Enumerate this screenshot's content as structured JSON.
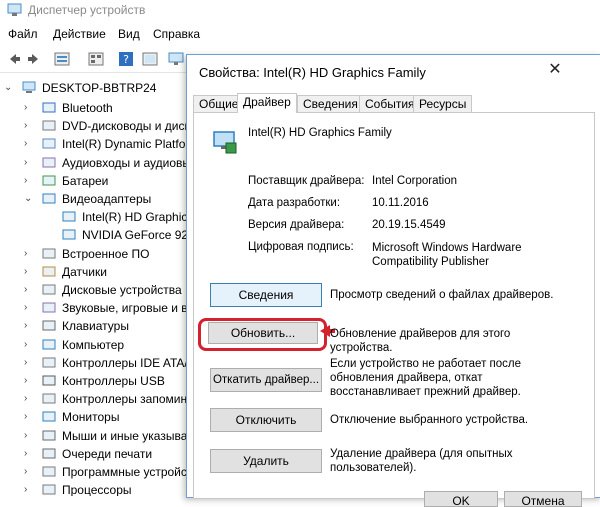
{
  "window": {
    "title": "Диспетчер устройств"
  },
  "menu": [
    "Файл",
    "Действие",
    "Вид",
    "Справка"
  ],
  "tree": {
    "root": "DESKTOP-BBTRP24",
    "items": [
      {
        "label": "Bluetooth",
        "depth": 1
      },
      {
        "label": "DVD-дисководы и дискс",
        "depth": 1
      },
      {
        "label": "Intel(R) Dynamic Platfor",
        "depth": 1
      },
      {
        "label": "Аудиовходы и аудиовы",
        "depth": 1
      },
      {
        "label": "Батареи",
        "depth": 1
      },
      {
        "label": "Видеоадаптеры",
        "depth": 1,
        "expanded": true
      },
      {
        "label": "Intel(R) HD Graphics",
        "depth": 2
      },
      {
        "label": "NVIDIA GeForce 920",
        "depth": 2
      },
      {
        "label": "Встроенное ПО",
        "depth": 1
      },
      {
        "label": "Датчики",
        "depth": 1
      },
      {
        "label": "Дисковые устройства",
        "depth": 1
      },
      {
        "label": "Звуковые, игровые и в",
        "depth": 1
      },
      {
        "label": "Клавиатуры",
        "depth": 1
      },
      {
        "label": "Компьютер",
        "depth": 1
      },
      {
        "label": "Контроллеры IDE ATA/",
        "depth": 1
      },
      {
        "label": "Контроллеры USB",
        "depth": 1
      },
      {
        "label": "Контроллеры запомин",
        "depth": 1
      },
      {
        "label": "Мониторы",
        "depth": 1
      },
      {
        "label": "Мыши и иные указыва",
        "depth": 1
      },
      {
        "label": "Очереди печати",
        "depth": 1
      },
      {
        "label": "Программные устройс",
        "depth": 1
      },
      {
        "label": "Процессоры",
        "depth": 1
      }
    ]
  },
  "dialog": {
    "title": "Свойства: Intel(R) HD Graphics Family",
    "close": "✕",
    "tabs": [
      "Общие",
      "Драйвер",
      "Сведения",
      "События",
      "Ресурсы"
    ],
    "active_tab": 1,
    "device_name": "Intel(R) HD Graphics Family",
    "properties": [
      {
        "key": "Поставщик драйвера:",
        "value": "Intel Corporation"
      },
      {
        "key": "Дата разработки:",
        "value": "10.11.2016"
      },
      {
        "key": "Версия драйвера:",
        "value": "20.19.15.4549"
      },
      {
        "key": "Цифровая подпись:",
        "value": "Microsoft Windows Hardware Compatibility Publisher"
      }
    ],
    "actions": [
      {
        "button": "Сведения",
        "desc": "Просмотр сведений о файлах драйверов."
      },
      {
        "button": "Обновить...",
        "desc": "Обновление драйверов для этого устройства."
      },
      {
        "button": "Откатить драйвер...",
        "desc": "Если устройство не работает после обновления драйвера, откат восстанавливает прежний драйвер."
      },
      {
        "button": "Отключить",
        "desc": "Отключение выбранного устройства."
      },
      {
        "button": "Удалить",
        "desc": "Удаление драйвера (для опытных пользователей)."
      }
    ],
    "footer": [
      "OK",
      "Отмена"
    ]
  },
  "colors": {
    "highlight": "#d3212d",
    "dialog_border": "#6f9fd6"
  }
}
